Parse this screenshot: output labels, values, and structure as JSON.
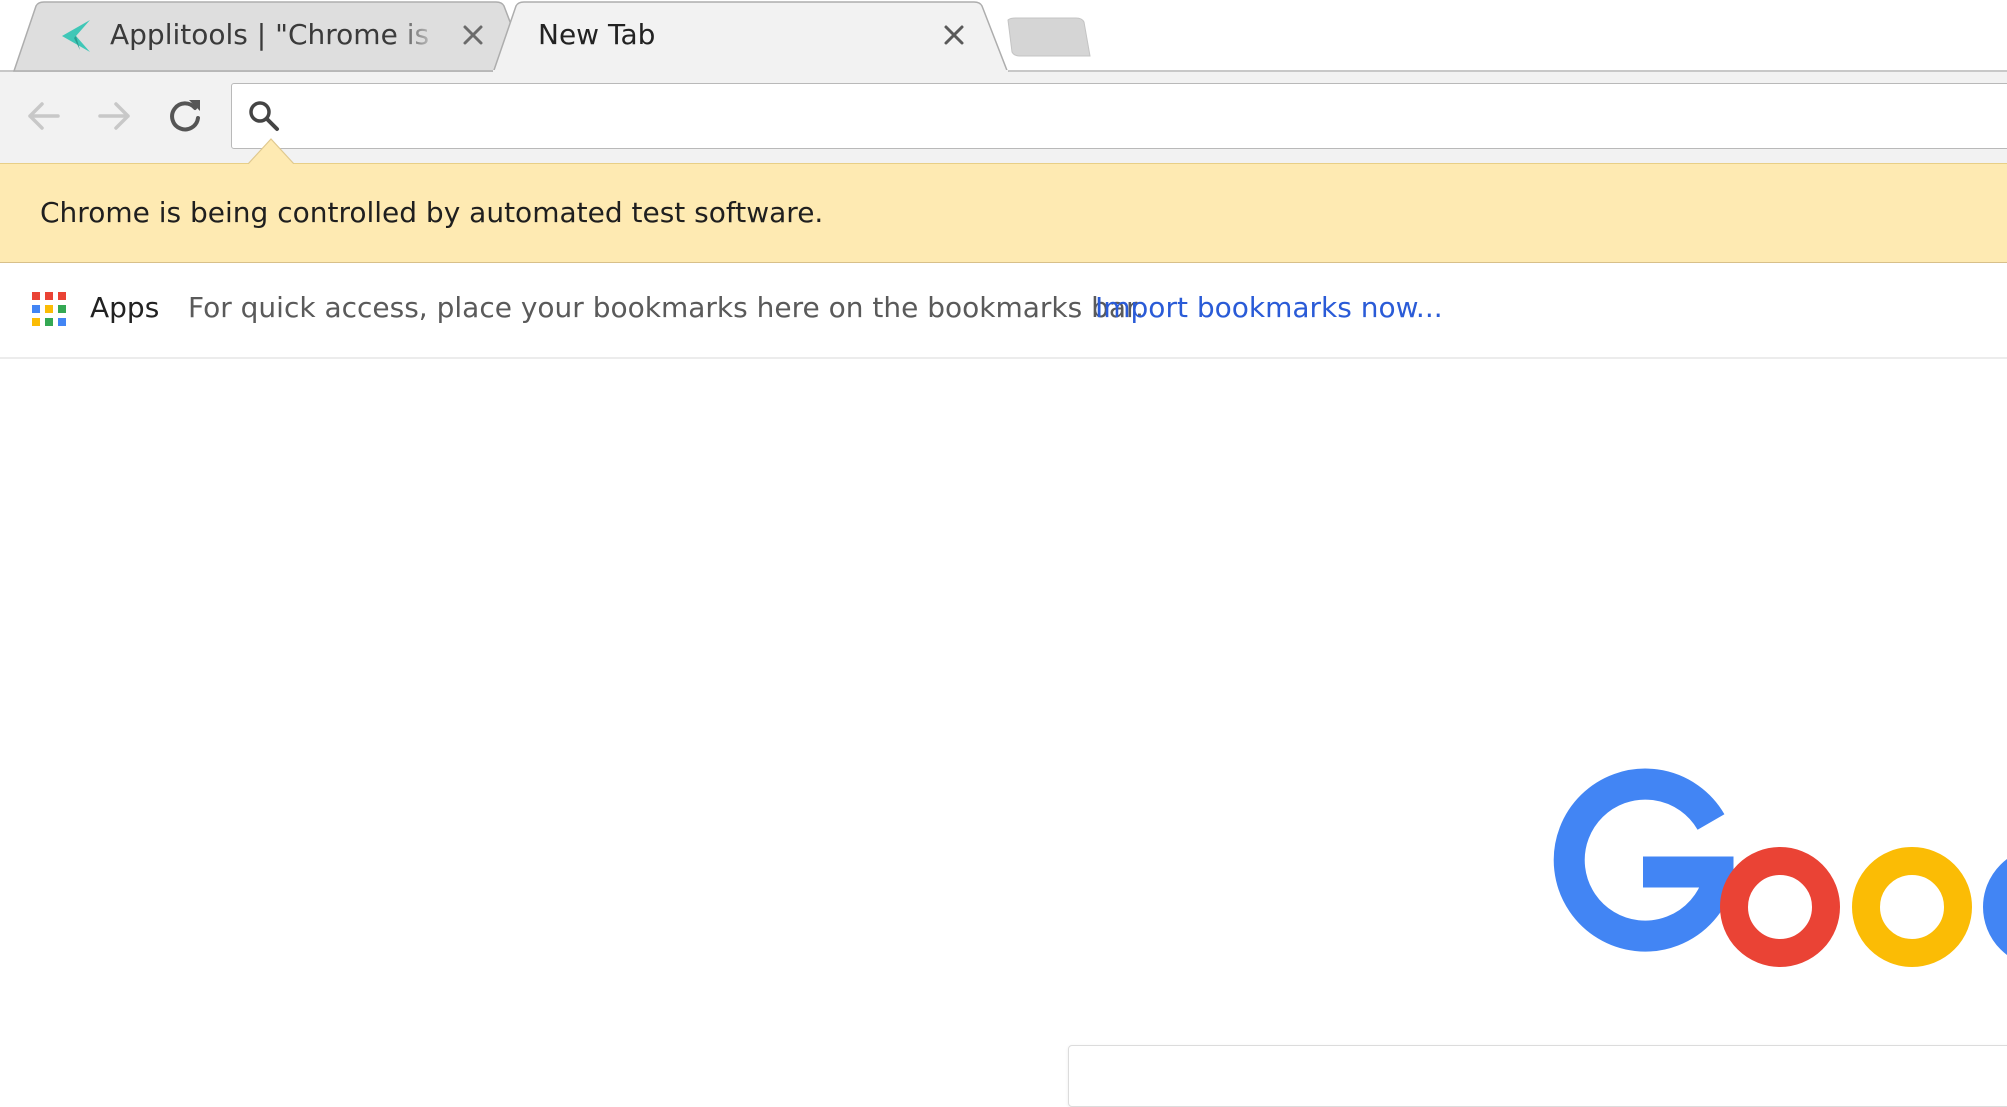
{
  "tabs": [
    {
      "title": "Applitools | \"Chrome is being controlled by automated test software\"",
      "active": false,
      "favicon": "applitools-icon"
    },
    {
      "title": "New Tab",
      "active": true,
      "favicon": ""
    }
  ],
  "toolbar": {
    "back_icon": "arrow-left-icon",
    "forward_icon": "arrow-right-icon",
    "reload_icon": "reload-icon",
    "omnibox_value": "",
    "omnibox_icon": "search-icon"
  },
  "infobar": {
    "message": "Chrome is being controlled by automated test software.",
    "background": "#feeab2"
  },
  "bookmarks_bar": {
    "apps_label": "Apps",
    "hint": "For quick access, place your bookmarks here on the bookmarks bar.",
    "import_link": "Import bookmarks now...",
    "link_color": "#2a5bd7"
  },
  "new_tab_page": {
    "logo_visible_letters": "Goog",
    "logo_colors": [
      "#4285F4",
      "#EA4335",
      "#FBBC05",
      "#4285F4"
    ]
  }
}
